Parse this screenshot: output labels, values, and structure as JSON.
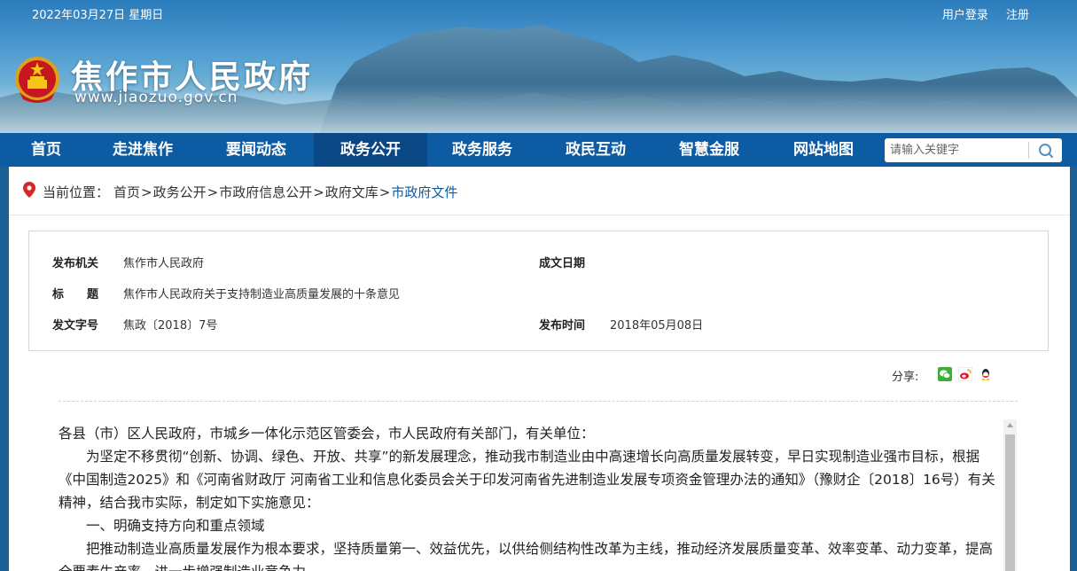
{
  "topbar": {
    "date": "2022年03月27日  星期日",
    "login": "用户登录",
    "register": "注册"
  },
  "site": {
    "title": "焦作市人民政府",
    "url": "www.jiaozuo.gov.cn"
  },
  "nav": {
    "items": [
      "首页",
      "走进焦作",
      "要闻动态",
      "政务公开",
      "政务服务",
      "政民互动",
      "智慧金服",
      "网站地图"
    ],
    "active_index": 3
  },
  "search": {
    "placeholder": "请输入关键字"
  },
  "breadcrumb": {
    "label": "当前位置：",
    "path": [
      "首页",
      "政务公开",
      "市政府信息公开",
      "政府文库",
      "市政府文件"
    ],
    "separator": ">"
  },
  "meta": {
    "issuer_label": "发布机关",
    "issuer": "焦作市人民政府",
    "date_created_label": "成文日期",
    "date_created": "",
    "title_label": "标　　题",
    "title": "焦作市人民政府关于支持制造业高质量发展的十条意见",
    "doc_no_label": "发文字号",
    "doc_no": "焦政〔2018〕7号",
    "publish_label": "发布时间",
    "publish_date": "2018年05月08日"
  },
  "share": {
    "label": "分享:",
    "icons": [
      "wechat-icon",
      "weibo-icon",
      "qq-icon"
    ]
  },
  "article": {
    "paragraphs": [
      "各县（市）区人民政府，市城乡一体化示范区管委会，市人民政府有关部门，有关单位：",
      "为坚定不移贯彻“创新、协调、绿色、开放、共享”的新发展理念，推动我市制造业由中高速增长向高质量发展转变，早日实现制造业强市目标，根据《中国制造2025》和《河南省财政厅 河南省工业和信息化委员会关于印发河南省先进制造业发展专项资金管理办法的通知》（豫财企〔2018〕16号）有关精神，结合我市实际，制定如下实施意见：",
      "一、明确支持方向和重点领域",
      "把推动制造业高质量发展作为根本要求，坚持质量第一、效益优先，以供给侧结构性改革为主线，推动经济发展质量变革、效率变革、动力变革，提高全要素生产率，进一步增强制造业竞争力"
    ]
  },
  "colors": {
    "nav_bg": "#0d5ca3",
    "nav_active": "#0a4785",
    "link_current": "#0d5ca3"
  }
}
